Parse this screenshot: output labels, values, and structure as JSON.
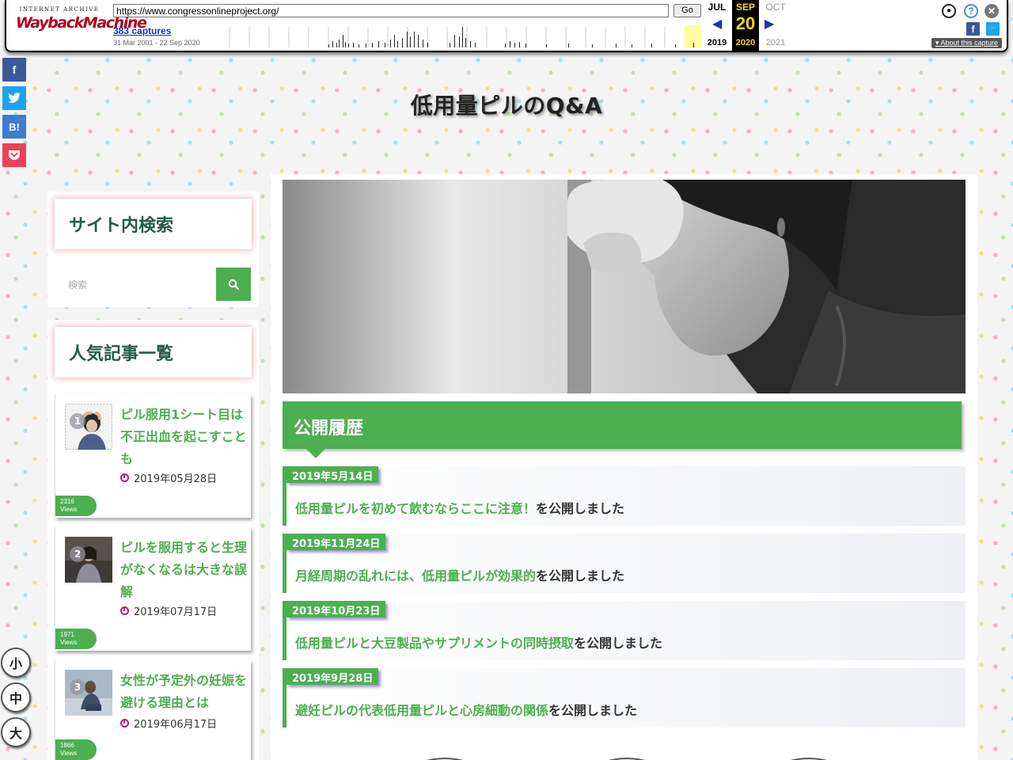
{
  "wayback": {
    "logo_top": "INTERNET ARCHIVE",
    "logo_main": "WaybackMachine",
    "url": "https://www.congressonlineproject.org/",
    "go_label": "Go",
    "captures": "383 captures",
    "range": "31 Mar 2001 - 22 Sep 2020",
    "prev_month": "JUL",
    "prev_year": "2019",
    "cur_month": "SEP",
    "cur_day": "20",
    "cur_year": "2020",
    "next_month": "OCT",
    "next_year": "2021",
    "about": "About this capture"
  },
  "social": {
    "facebook": "f",
    "twitter": "t",
    "hatena": "B!",
    "pocket": "P"
  },
  "font_size": {
    "small": "小",
    "medium": "中",
    "large": "大"
  },
  "site": {
    "title": "低用量ピルのQ&A"
  },
  "sidebar": {
    "search_heading": "サイト内検索",
    "search_placeholder": "検索",
    "popular_heading": "人気記事一覧",
    "popular": [
      {
        "rank": "1",
        "title": "ピル服用1シート目は不正出血を起こすことも",
        "date": "2019年05月28日",
        "views_count": "2316",
        "views_label": "Views"
      },
      {
        "rank": "2",
        "title": "ピルを服用すると生理がなくなるは大きな誤解",
        "date": "2019年07月17日",
        "views_count": "1971",
        "views_label": "Views"
      },
      {
        "rank": "3",
        "title": "女性が予定外の妊娠を避ける理由とは",
        "date": "2019年06月17日",
        "views_count": "1866",
        "views_label": "Views"
      }
    ]
  },
  "main": {
    "history_heading": "公開履歴",
    "suffix": "を公開しました",
    "entries": [
      {
        "date": "2019年5月14日",
        "title": "低用量ピルを初めて飲むならここに注意！"
      },
      {
        "date": "2019年11月24日",
        "title": "月経周期の乱れには、低用量ピルが効果的"
      },
      {
        "date": "2019年10月23日",
        "title": "低用量ピルと大豆製品やサプリメントの同時摂取"
      },
      {
        "date": "2019年9月28日",
        "title": "避妊ピルの代表低用量ピルと心房細動の関係"
      }
    ]
  },
  "colors": {
    "accent": "#4caf50",
    "heading_text": "#225c4c",
    "clock": "#c0197a"
  }
}
